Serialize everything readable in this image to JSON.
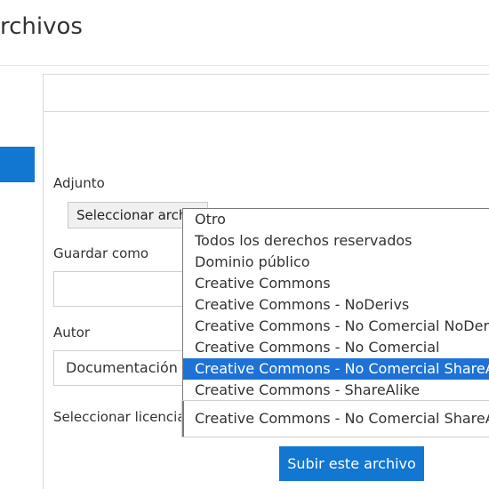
{
  "page": {
    "title": "rchivos"
  },
  "form": {
    "attachment_label": "Adjunto",
    "file_button": "Seleccionar arch",
    "save_as_label": "Guardar como",
    "save_as_value": "",
    "author_label": "Autor",
    "author_value": "Documentación E",
    "license_label": "Seleccionar licencia",
    "license_selected": "Creative Commons - No Comercial ShareAlike",
    "submit_label": "Subir este archivo"
  },
  "license_options": [
    "Otro",
    "Todos los derechos reservados",
    "Dominio público",
    "Creative Commons",
    "Creative Commons - NoDerivs",
    "Creative Commons - No Comercial NoDerivs",
    "Creative Commons - No Comercial",
    "Creative Commons - No Comercial ShareAlike",
    "Creative Commons - ShareAlike"
  ],
  "license_selected_index": 7,
  "colors": {
    "accent": "#1177d1",
    "selected_option": "#1e72d6"
  }
}
